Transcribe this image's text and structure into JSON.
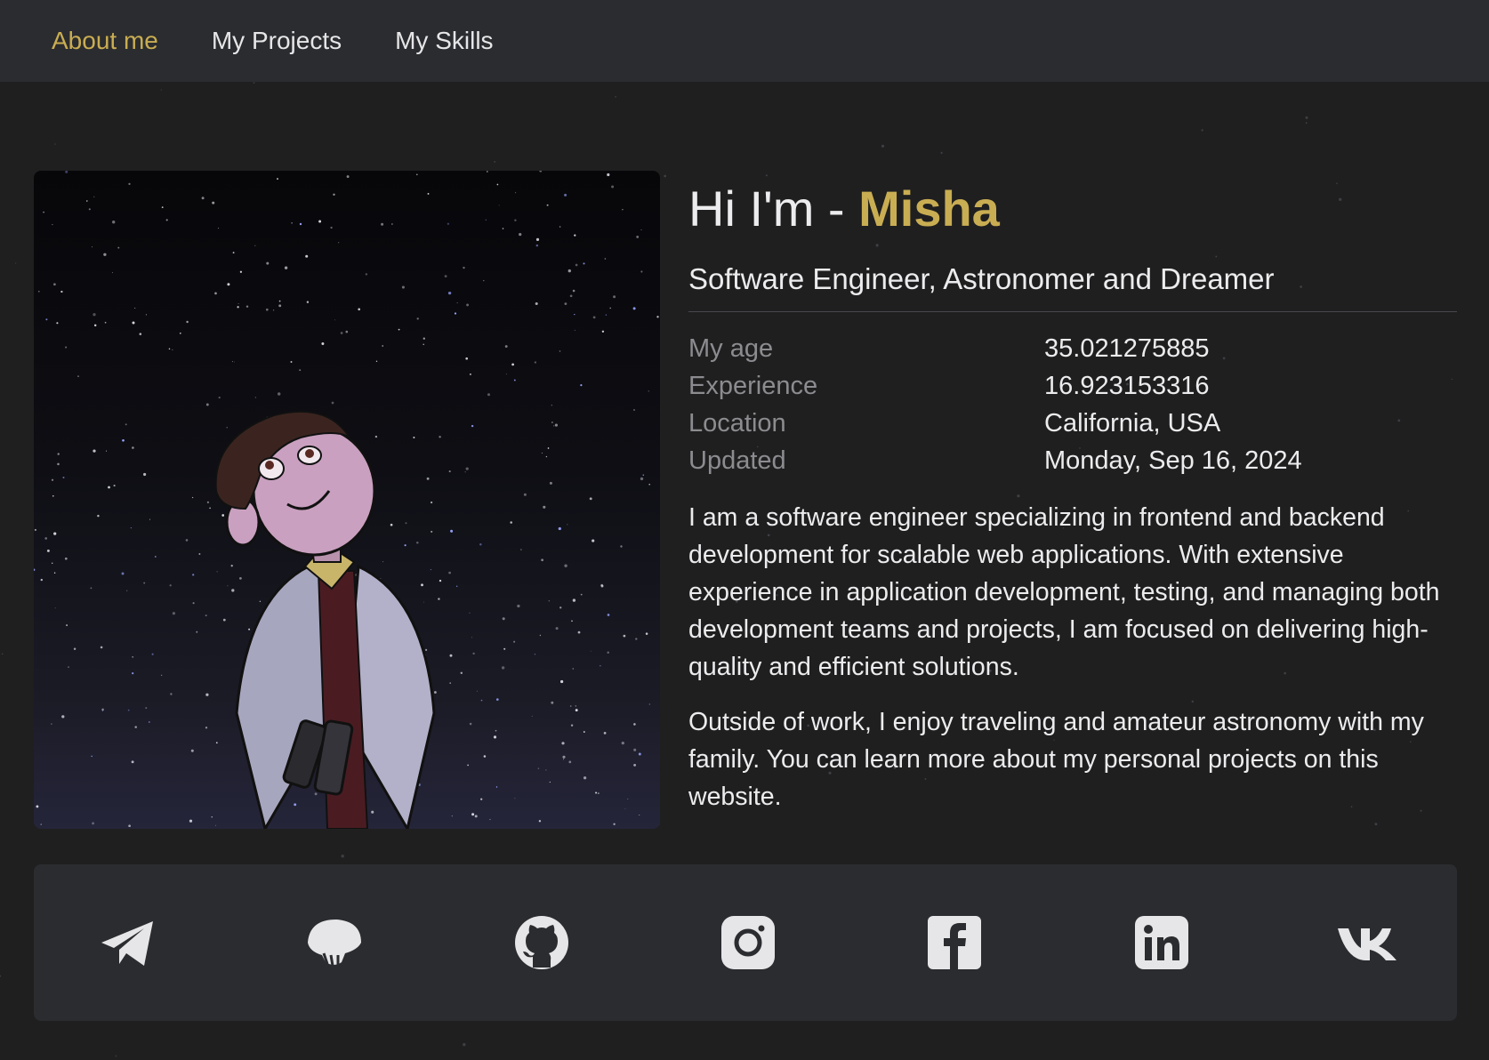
{
  "nav": {
    "items": [
      {
        "label": "About me",
        "active": true
      },
      {
        "label": "My Projects",
        "active": false
      },
      {
        "label": "My Skills",
        "active": false
      }
    ]
  },
  "hero": {
    "greeting": "Hi I'm - ",
    "name": "Misha",
    "subtitle": "Software Engineer, Astronomer and Dreamer"
  },
  "facts": [
    {
      "label": "My age",
      "value": "35.021275885"
    },
    {
      "label": "Experience",
      "value": "16.923153316"
    },
    {
      "label": "Location",
      "value": "California, USA"
    },
    {
      "label": "Updated",
      "value": "Monday, Sep 16, 2024"
    }
  ],
  "about": {
    "paragraph1": "I am a software engineer specializing in frontend and backend development for scalable web applications. With extensive experience in application development, testing, and managing both development teams and projects, I am focused on delivering high-quality and efficient solutions.",
    "paragraph2": "Outside of work, I enjoy traveling and amateur astronomy with my family. You can learn more about my personal projects on this website."
  },
  "social": [
    {
      "icon": "telegram-icon"
    },
    {
      "icon": "mushroom-icon"
    },
    {
      "icon": "github-icon"
    },
    {
      "icon": "instagram-icon"
    },
    {
      "icon": "facebook-icon"
    },
    {
      "icon": "linkedin-icon"
    },
    {
      "icon": "vk-icon"
    }
  ],
  "colors": {
    "accent": "#c9ad52",
    "background": "#1f1f20",
    "panel": "#2b2c2f",
    "muted_text": "#8c8c90",
    "icon": "#e6e6e8"
  }
}
